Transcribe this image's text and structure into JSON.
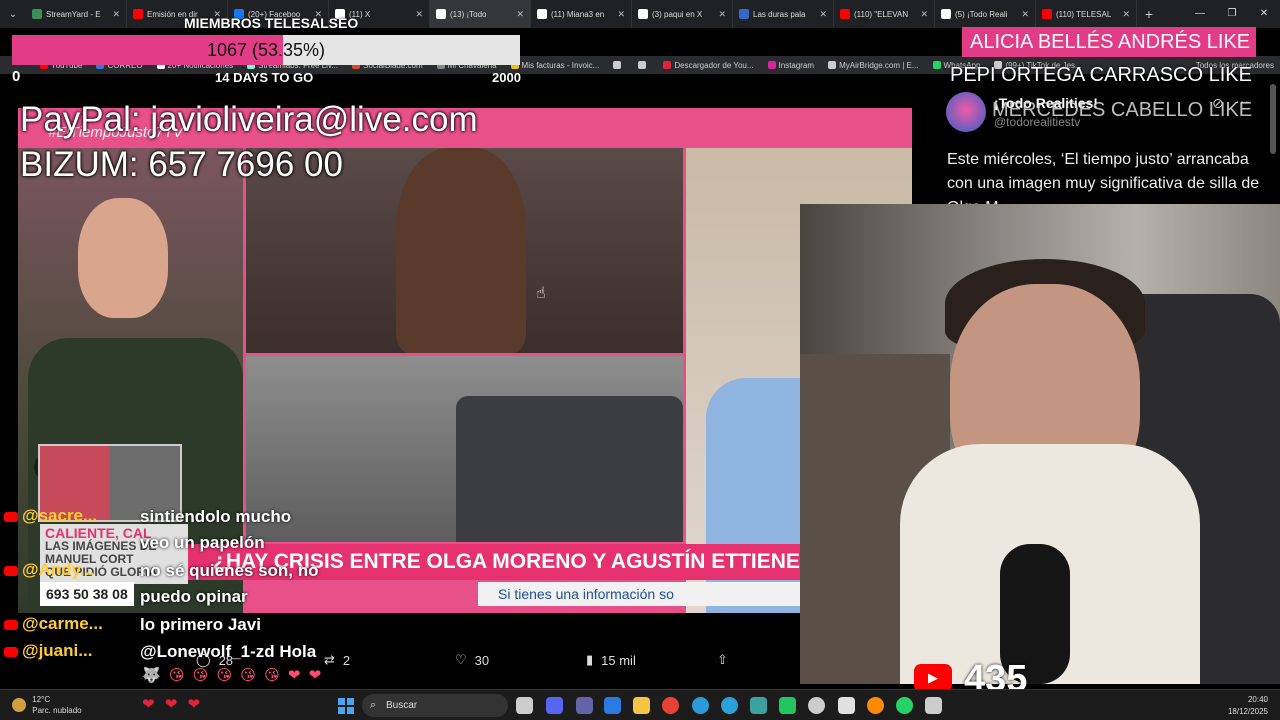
{
  "browser": {
    "tabs": [
      {
        "label": "StreamYard - E",
        "color": "#3a8f5a"
      },
      {
        "label": "Emisión en dir",
        "color": "#ff0000"
      },
      {
        "label": "(20+) Faceboo",
        "color": "#1877f2"
      },
      {
        "label": "(11) X",
        "color": "#ffffff"
      },
      {
        "label": "(13) ¡Todo",
        "color": "#ffffff"
      },
      {
        "label": "(11) Miana3 en",
        "color": "#ffffff"
      },
      {
        "label": "(3) paqui en X",
        "color": "#ffffff"
      },
      {
        "label": "Las duras pala",
        "color": "#3468c9"
      },
      {
        "label": "(110) \"ELEVAN",
        "color": "#ff0000"
      },
      {
        "label": "(5) ¡Todo Reali",
        "color": "#ffffff"
      },
      {
        "label": "(110) TELESAL",
        "color": "#ff0000"
      }
    ],
    "active_tab_index": 4,
    "bookmarks": [
      {
        "label": "YouTube",
        "color": "#ff0000"
      },
      {
        "label": "CORREO",
        "color": "#2a7ae2"
      },
      {
        "label": "20+ Notificaciones",
        "color": "#ffffff"
      },
      {
        "label": "Streamlabs: Free Liv...",
        "color": "#80f5d2"
      },
      {
        "label": "SocialBlade.com",
        "color": "#d24b2a"
      },
      {
        "label": "Mi Chavaleria",
        "color": "#888888"
      },
      {
        "label": "Mis facturas - Invoic...",
        "color": "#f0c000"
      },
      {
        "label": "",
        "color": "#cccccc"
      },
      {
        "label": "",
        "color": "#cccccc"
      },
      {
        "label": "Descargador de You...",
        "color": "#e2233c"
      },
      {
        "label": "Instagram",
        "color": "#d6249f"
      },
      {
        "label": "MyAirBridge.com | E...",
        "color": "#cccccc"
      },
      {
        "label": "WhatsApp",
        "color": "#25d366"
      },
      {
        "label": "(99+) TikTok de Jes...",
        "color": "#cccccc"
      }
    ],
    "all_bookmarks": "Todos los marcadores"
  },
  "goal": {
    "title": "MIEMBROS TELESALSEO",
    "progress_text": "1067 (53.35%)",
    "progress_fraction": 0.5335,
    "min": "0",
    "max": "2000",
    "days_left": "14 DAYS TO GO",
    "fill_color": "#e23c87"
  },
  "likes": {
    "line1": "ALICIA BELLÉS ANDRÉS  LIKE",
    "line2": "PEPI ORTEGA CARRASCO  LIKE",
    "line3": "MERCEDES CABELLO  LIKE"
  },
  "donation": {
    "paypal": "PayPal: javioliveira@live.com",
    "bizum": "BIZUM: 657 7696 00"
  },
  "video": {
    "hashtag": "#ElTiempoJusto7TV",
    "headline": "¿HAY CRISIS ENTRE OLGA MORENO Y AGUSTÍN ETTIENE?",
    "subline": "Si tienes una información so",
    "phone": "693 50 38 08",
    "side_caption": {
      "line1": "CALIENTE, CAL",
      "line2": "LAS IMÁGENES DE",
      "line3": "MANUEL CORT",
      "line4": "QUE PIDIÓ GLORIA"
    }
  },
  "tweet": {
    "name": "¡Todo Realities!",
    "handle": "@todorealitiestv",
    "text": "Este miércoles, ‘El tiempo justo’ arrancaba con una imagen muy significativa de silla de Olga M",
    "actions": {
      "replies": "28",
      "reposts": "2",
      "likes": "30",
      "views": "15 mil"
    }
  },
  "chat": [
    {
      "user": "@sacre...",
      "message": "sintiendolo mucho"
    },
    {
      "user": "",
      "message": "veo un papelón"
    },
    {
      "user": "@Andy...",
      "message": "no sé quienes son, no"
    },
    {
      "user": "",
      "message": "puedo opinar"
    },
    {
      "user": "@carme...",
      "message": "lo primero Javi"
    },
    {
      "user": "@juani...",
      "message": "@Lonewolf_1-zd Hola"
    }
  ],
  "chat_emojis": "🐺 😘 😘 😘 😘 😘 ❤ ❤",
  "viewers": "435",
  "taskbar": {
    "weather_temp": "12°C",
    "weather_desc": "Parc. nublado",
    "search_placeholder": "Buscar",
    "time": "20:40",
    "date": "18/12/2025",
    "hearts": "❤ ❤ ❤"
  }
}
